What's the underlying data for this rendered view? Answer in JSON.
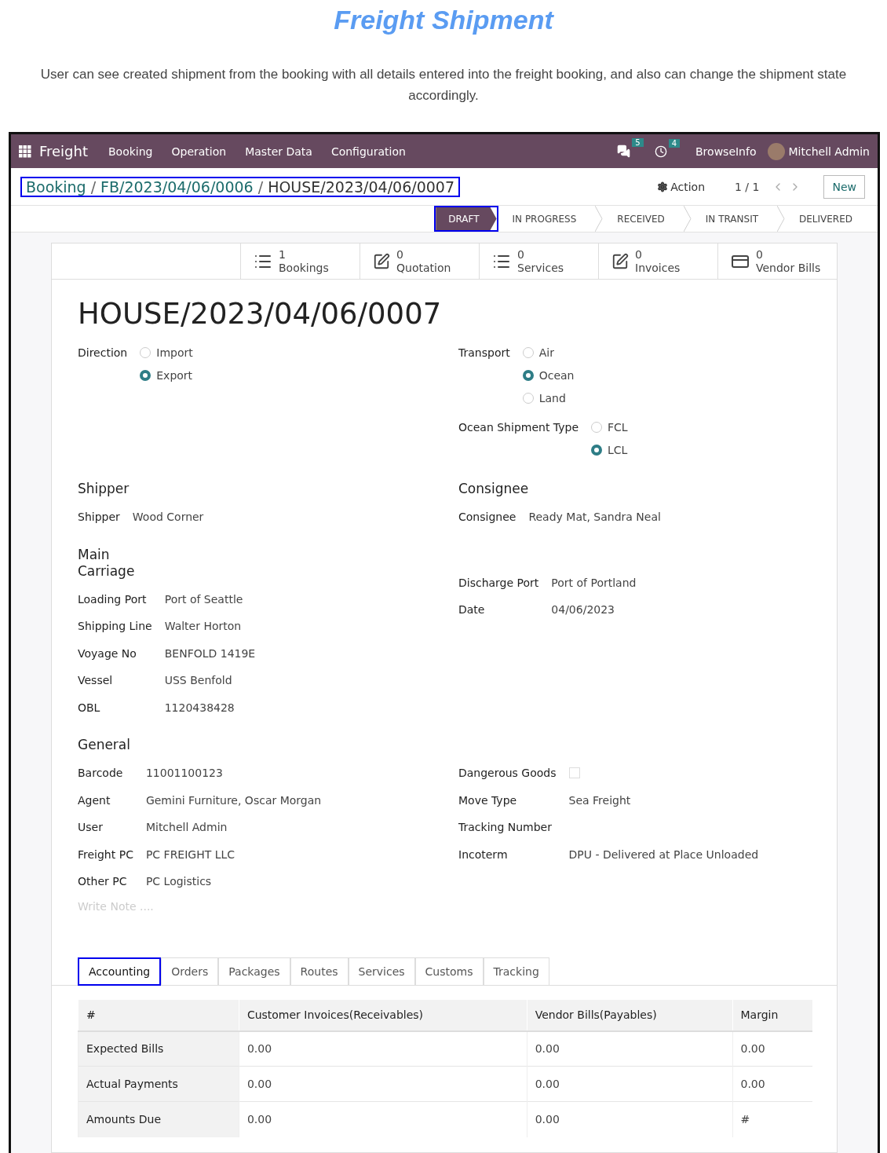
{
  "page": {
    "title": "Freight Shipment",
    "description": "User can see created shipment from the booking with all details entered into the freight booking, and also can change the shipment state accordingly."
  },
  "navbar": {
    "app": "Freight",
    "menu": [
      "Booking",
      "Operation",
      "Master Data",
      "Configuration"
    ],
    "messages_count": "5",
    "activities_count": "4",
    "company": "BrowseInfo",
    "user": "Mitchell Admin"
  },
  "control_panel": {
    "highlighted": true,
    "breadcrumb": [
      {
        "kind": "link",
        "label": "Booking"
      },
      {
        "kind": "separator",
        "label": "/"
      },
      {
        "kind": "link",
        "label": "FB/2023/04/06/0006"
      },
      {
        "kind": "separator",
        "label": "/"
      },
      {
        "kind": "current",
        "label": "HOUSE/2023/04/06/0007"
      }
    ],
    "action": "Action",
    "pager": "1 / 1",
    "new_button": "New"
  },
  "status_bar": [
    {
      "label": "DRAFT",
      "selected": true,
      "highlighted": true
    },
    {
      "label": "IN PROGRESS",
      "selected": false,
      "highlighted": false
    },
    {
      "label": "RECEIVED",
      "selected": false,
      "highlighted": false
    },
    {
      "label": "IN TRANSIT",
      "selected": false,
      "highlighted": false
    },
    {
      "label": "DELIVERED",
      "selected": false,
      "highlighted": false
    }
  ],
  "smart_buttons": [
    {
      "kind": "list",
      "count": "1",
      "label": "Bookings"
    },
    {
      "kind": "edit",
      "count": "0",
      "label": "Quotation"
    },
    {
      "kind": "list",
      "count": "0",
      "label": "Services"
    },
    {
      "kind": "edit",
      "count": "0",
      "label": "Invoices"
    },
    {
      "kind": "card",
      "count": "0",
      "label": "Vendor Bills"
    }
  ],
  "record_title": "HOUSE/2023/04/06/0007",
  "radio_groups_left": [
    {
      "label": "Direction",
      "options": [
        {
          "label": "Import",
          "selected": false
        },
        {
          "label": "Export",
          "selected": true
        }
      ]
    }
  ],
  "radio_groups_right": [
    {
      "label": "Transport",
      "options": [
        {
          "label": "Air",
          "selected": false
        },
        {
          "label": "Ocean",
          "selected": true
        },
        {
          "label": "Land",
          "selected": false
        }
      ]
    },
    {
      "label": "Ocean Shipment Type",
      "options": [
        {
          "label": "FCL",
          "selected": false
        },
        {
          "label": "LCL",
          "selected": true
        }
      ]
    }
  ],
  "sections": [
    {
      "left_heading": "Shipper",
      "right_heading": "Consignee",
      "left_fields": [
        {
          "kind": "text",
          "label": "Shipper",
          "value": "Wood Corner"
        }
      ],
      "right_fields": [
        {
          "kind": "text",
          "label": "Consignee",
          "value": "Ready Mat, Sandra Neal"
        }
      ]
    },
    {
      "left_heading": "Main Carriage",
      "left_fields": [
        {
          "kind": "text",
          "label": "Loading Port",
          "value": "Port of Seattle"
        },
        {
          "kind": "text",
          "label": "Shipping Line",
          "value": "Walter Horton"
        },
        {
          "kind": "text",
          "label": "Voyage No",
          "value": "BENFOLD 1419E"
        },
        {
          "kind": "text",
          "label": "Vessel",
          "value": "USS Benfold"
        },
        {
          "kind": "text",
          "label": "OBL",
          "value": "1120438428"
        }
      ],
      "right_fields": [
        {
          "kind": "text",
          "label": "Discharge Port",
          "value": "Port of Portland"
        },
        {
          "kind": "text",
          "label": "Date",
          "value": "04/06/2023"
        }
      ]
    },
    {
      "left_heading": "General",
      "left_fields": [
        {
          "kind": "text",
          "label": "Barcode",
          "value": "11001100123"
        },
        {
          "kind": "text",
          "label": "Agent",
          "value": "Gemini Furniture, Oscar Morgan"
        },
        {
          "kind": "text",
          "label": "User",
          "value": "Mitchell Admin"
        },
        {
          "kind": "text",
          "label": "Freight PC",
          "value": "PC FREIGHT LLC"
        },
        {
          "kind": "text",
          "label": "Other PC",
          "value": "PC Logistics"
        }
      ],
      "right_fields": [
        {
          "kind": "checkbox",
          "label": "Dangerous Goods",
          "checked": false
        },
        {
          "kind": "text",
          "label": "Move Type",
          "value": "Sea Freight"
        },
        {
          "kind": "text",
          "label": "Tracking Number"
        },
        {
          "kind": "text",
          "label": "Incoterm",
          "value": "DPU - Delivered at Place Unloaded"
        }
      ]
    }
  ],
  "note": {
    "placeholder": "Write Note ...."
  },
  "tabs": [
    {
      "label": "Accounting",
      "selected": true,
      "highlighted": true
    },
    {
      "label": "Orders",
      "selected": false,
      "highlighted": false
    },
    {
      "label": "Packages",
      "selected": false,
      "highlighted": false
    },
    {
      "label": "Routes",
      "selected": false,
      "highlighted": false
    },
    {
      "label": "Services",
      "selected": false,
      "highlighted": false
    },
    {
      "label": "Customs",
      "selected": false,
      "highlighted": false
    },
    {
      "label": "Tracking",
      "selected": false,
      "highlighted": false
    }
  ],
  "table": {
    "columns": [
      "#",
      "Customer Invoices(Receivables)",
      "Vendor Bills(Payables)",
      "Margin"
    ],
    "rows": [
      [
        "Expected Bills",
        "0.00",
        "0.00",
        "0.00"
      ],
      [
        "Actual Payments",
        "0.00",
        "0.00",
        "0.00"
      ],
      [
        "Amounts Due",
        "0.00",
        "0.00",
        "#"
      ]
    ]
  }
}
